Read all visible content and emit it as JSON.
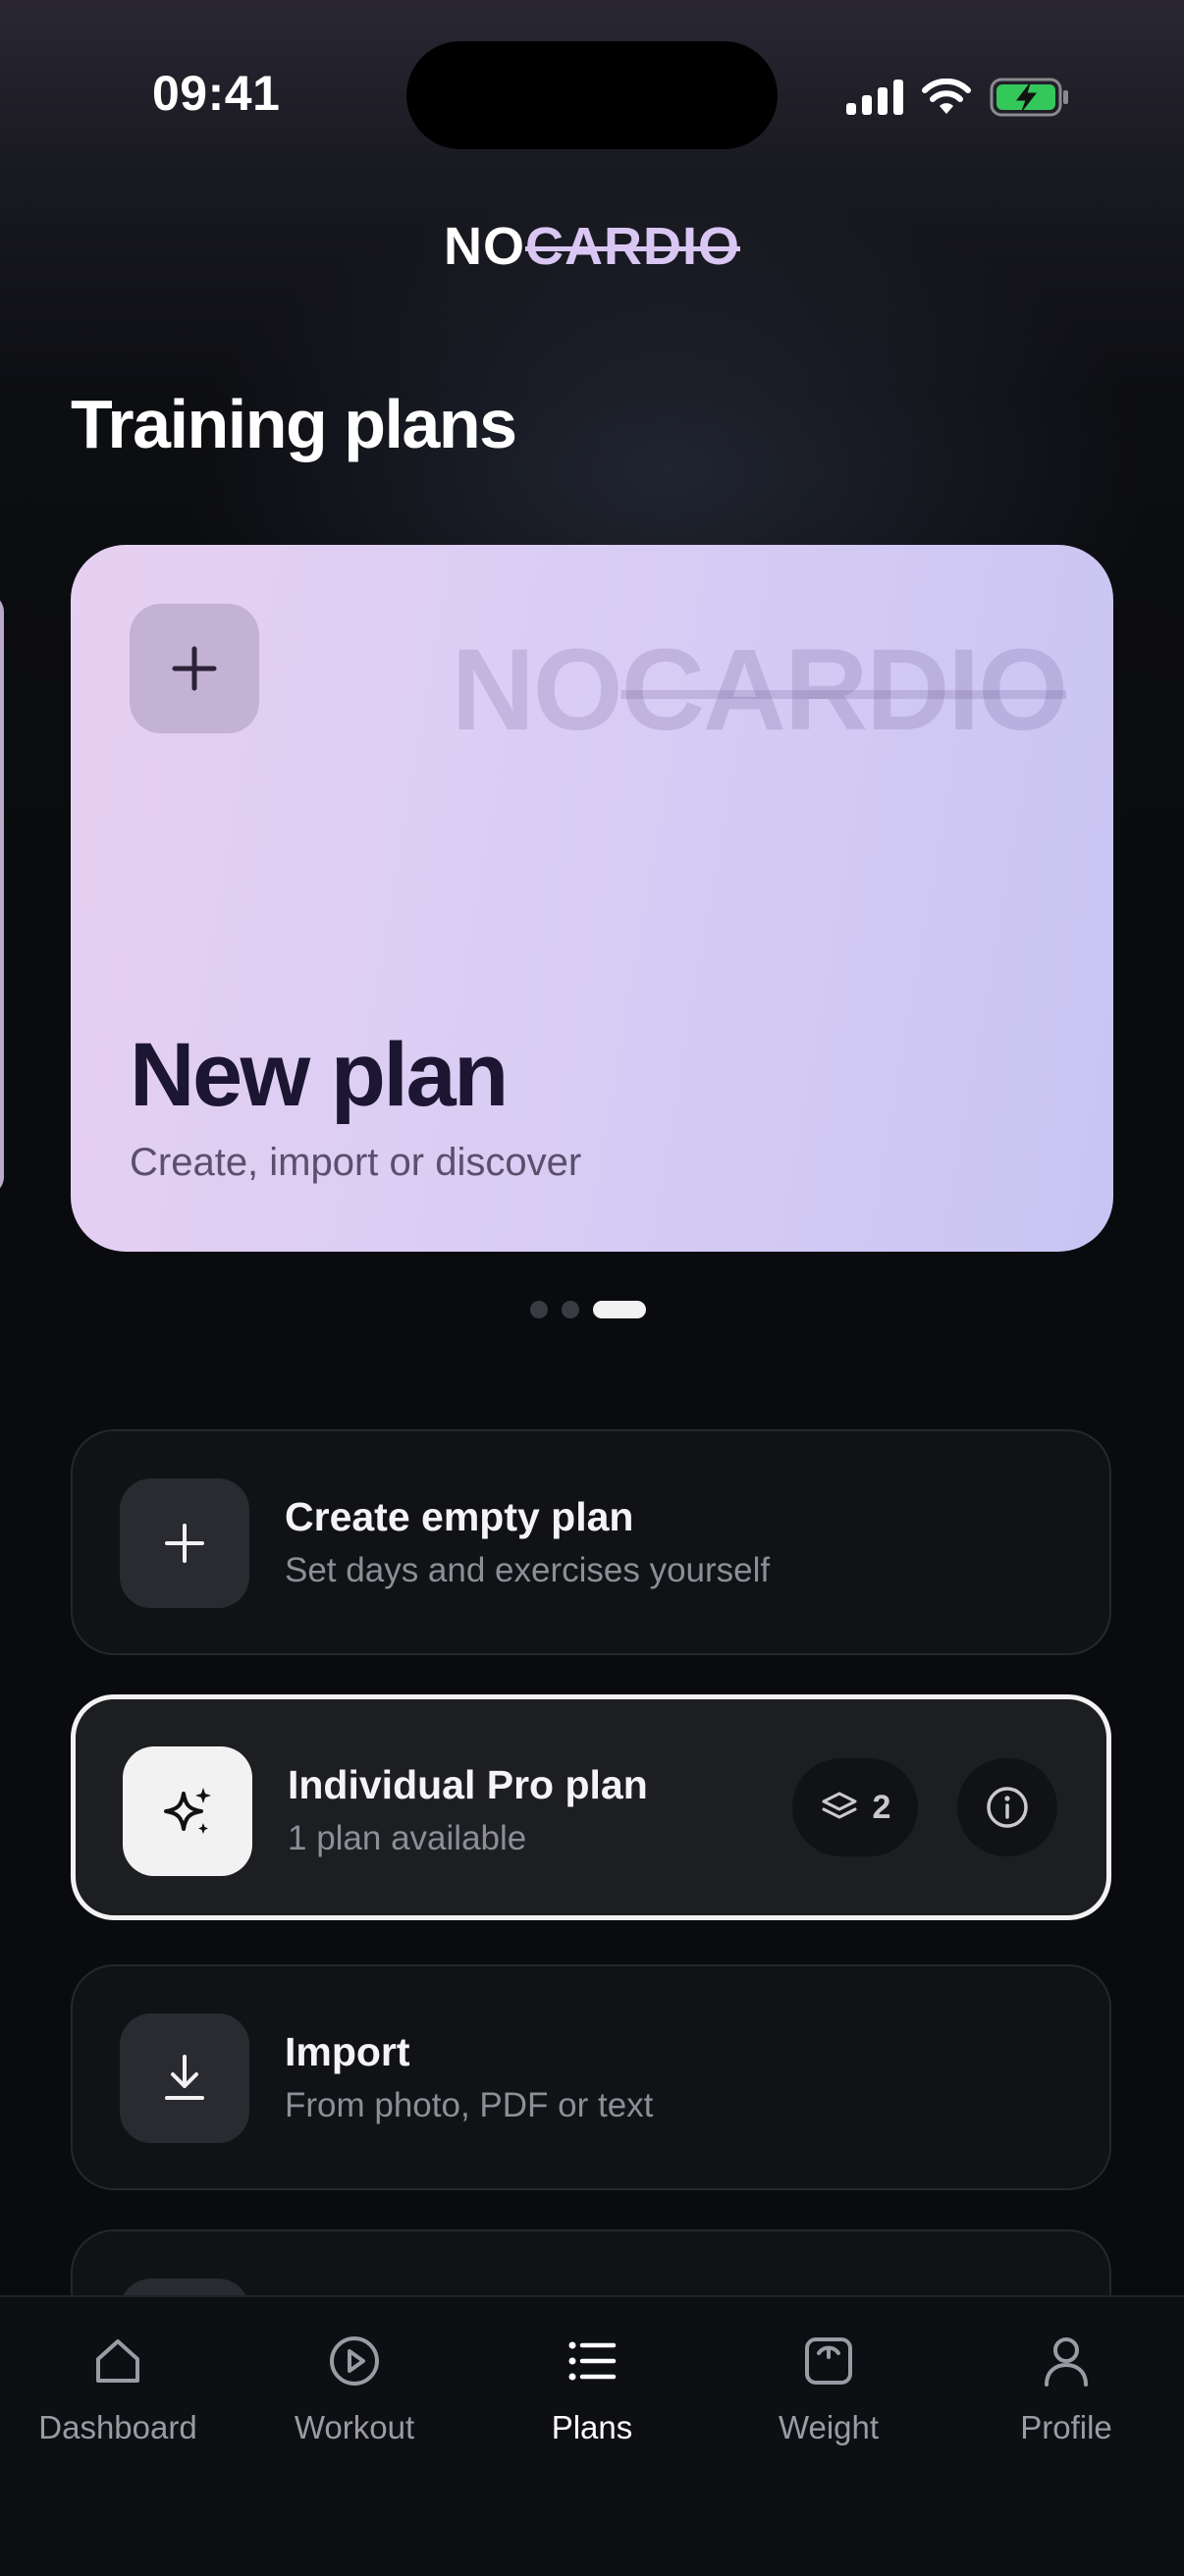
{
  "status": {
    "time": "09:41"
  },
  "brand": {
    "no": "NO",
    "cardio": "CARDIO"
  },
  "page": {
    "title": "Training plans"
  },
  "featured_card": {
    "title": "New plan",
    "subtitle": "Create, import or discover",
    "watermark_no": "NO",
    "watermark_cardio": "CARDIO",
    "icon": "plus-icon"
  },
  "carousel": {
    "page_count": 3,
    "active_index": 2
  },
  "options": [
    {
      "title": "Create empty plan",
      "subtitle": "Set days and exercises yourself",
      "icon": "plus-icon"
    },
    {
      "title": "Individual Pro plan",
      "subtitle": "1 plan available",
      "icon": "sparkle-icon",
      "badge_count": "2"
    },
    {
      "title": "Import",
      "subtitle": "From photo, PDF or text",
      "icon": "download-icon"
    }
  ],
  "tabs": [
    {
      "label": "Dashboard",
      "icon": "home-icon"
    },
    {
      "label": "Workout",
      "icon": "play-circle-icon"
    },
    {
      "label": "Plans",
      "icon": "list-icon",
      "active": true
    },
    {
      "label": "Weight",
      "icon": "scale-icon"
    },
    {
      "label": "Profile",
      "icon": "person-icon"
    }
  ],
  "colors": {
    "background": "#0a0b0e",
    "card_gradient_start": "#e7d0f1",
    "card_gradient_end": "#c9c4f3",
    "brand_accent": "#d9c6f2",
    "battery_green": "#34c759"
  }
}
